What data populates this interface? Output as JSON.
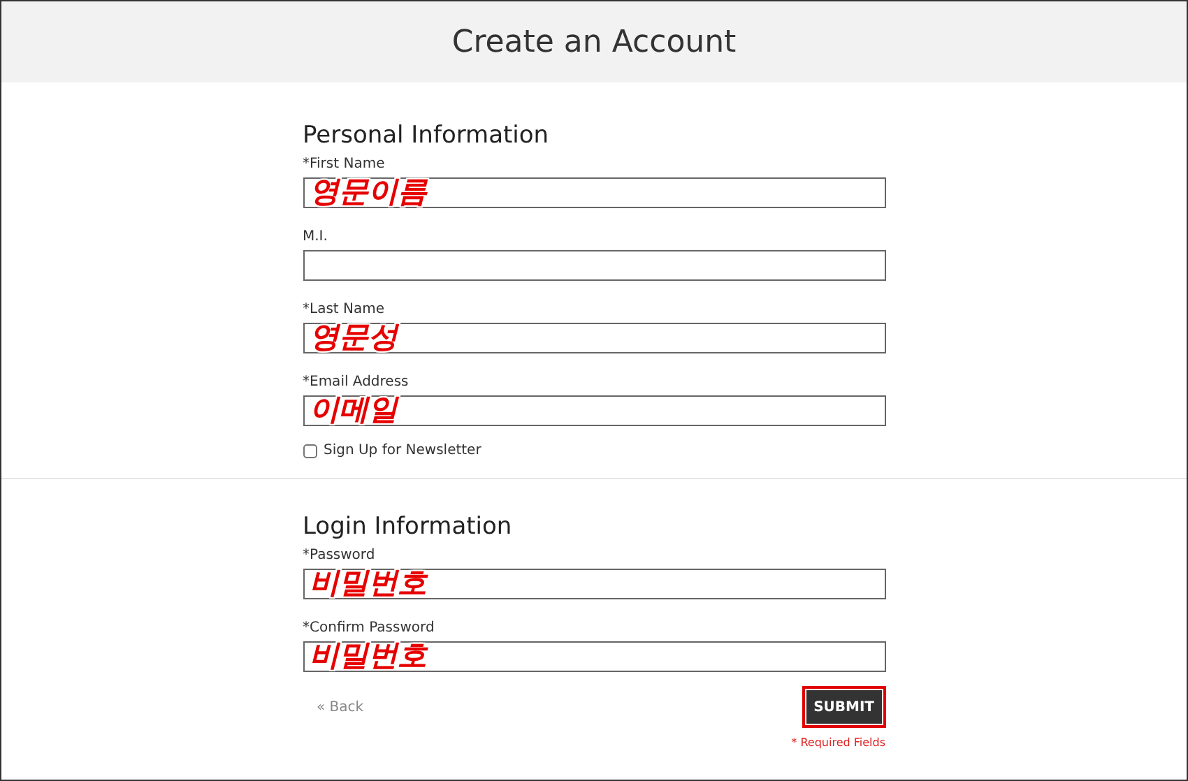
{
  "header": {
    "title": "Create an Account"
  },
  "sections": [
    {
      "title": "Personal Information",
      "fields": [
        {
          "label": "*First Name",
          "annotation": "영문이름"
        },
        {
          "label": "M.I."
        },
        {
          "label": "*Last Name",
          "annotation": "영문성"
        },
        {
          "label": "*Email Address",
          "annotation": "이메일"
        }
      ],
      "checkbox": {
        "label": "Sign Up for Newsletter",
        "checked": false
      }
    },
    {
      "title": "Login Information",
      "fields": [
        {
          "label": "*Password",
          "annotation": "비밀번호"
        },
        {
          "label": "*Confirm Password",
          "annotation": "비밀번호"
        }
      ]
    }
  ],
  "actions": {
    "back": "« Back",
    "submit": "SUBMIT",
    "submit_highlighted": true,
    "required_note": "* Required Fields"
  }
}
